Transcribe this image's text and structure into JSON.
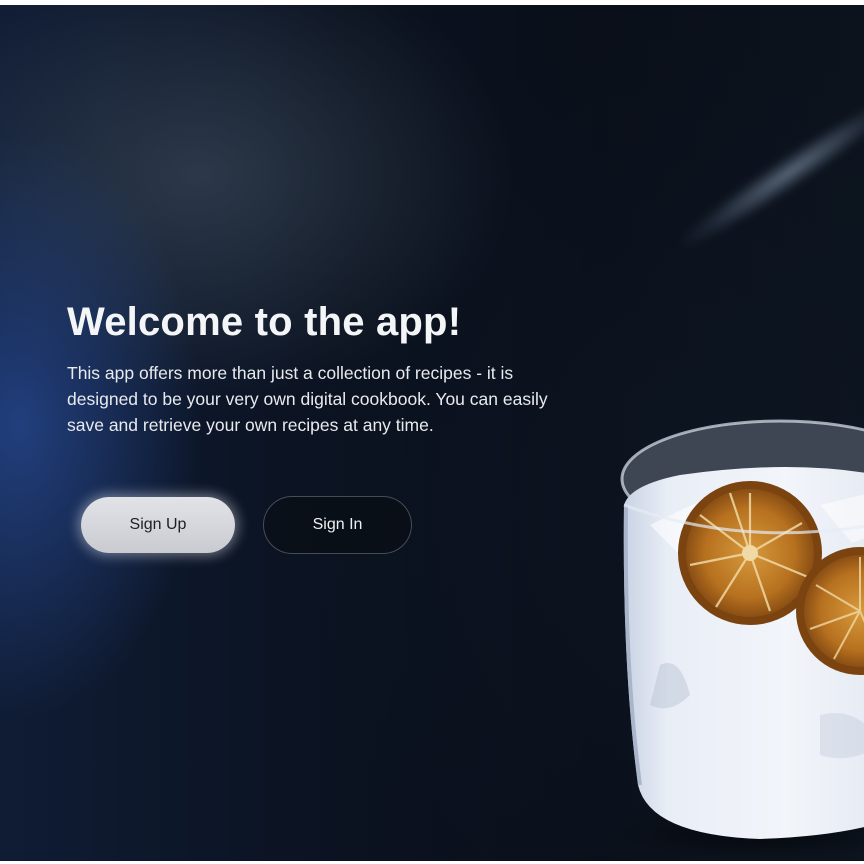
{
  "hero": {
    "title": "Welcome to the app!",
    "description": "This app offers more than just a collection of recipes - it is designed to be your very own digital cookbook. You can easily save and retrieve your own recipes at any time."
  },
  "actions": {
    "sign_up_label": "Sign Up",
    "sign_in_label": "Sign In"
  },
  "colors": {
    "background": "#0b1220",
    "accent_blue": "#284b96",
    "title_text": "#f4f5f7",
    "primary_button_bg": "#d7d8dd",
    "primary_button_text": "#1c1f26",
    "secondary_button_border": "#78808c"
  },
  "images": {
    "drink": "cocktail-glass-with-dried-orange-slices"
  }
}
